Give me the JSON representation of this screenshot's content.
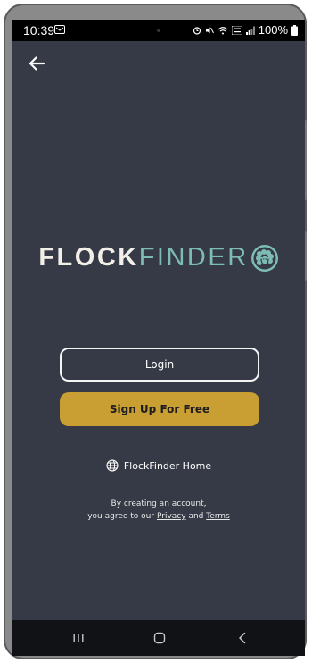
{
  "status": {
    "time": "10:39",
    "battery": "100%"
  },
  "icons": {
    "back": "arrow-left-icon",
    "globe": "globe-icon",
    "logo_badge": "sheep-badge-icon",
    "nav_recents": "recents-icon",
    "nav_home": "home-icon",
    "nav_back": "chevron-left-icon"
  },
  "logo": {
    "part1": "FLOCK",
    "part2": "FINDER"
  },
  "buttons": {
    "login": "Login",
    "signup": "Sign Up For Free"
  },
  "home_link": "FlockFinder Home",
  "legal": {
    "line1": "By creating an account,",
    "line2_prefix": "you agree to our",
    "privacy": "Privacy",
    "and": "and",
    "terms": "Terms"
  },
  "colors": {
    "background": "#353a46",
    "accent_gold": "#c99e32",
    "logo_teal": "#7dbcb5",
    "logo_cream": "#f1efe8"
  }
}
